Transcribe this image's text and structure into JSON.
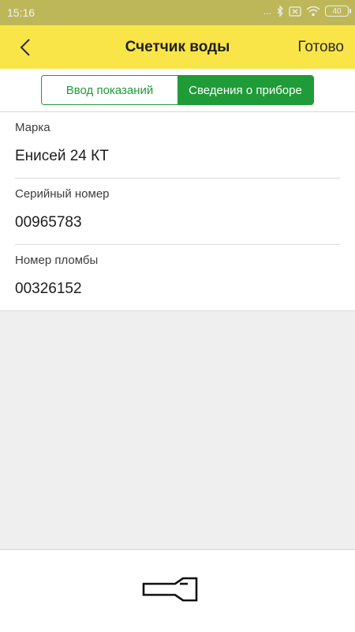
{
  "status_bar": {
    "time": "15:16",
    "dots": "...",
    "battery": "40",
    "icons": [
      "bluetooth-icon",
      "sim-icon",
      "wifi-icon",
      "battery-icon"
    ]
  },
  "app_bar": {
    "title": "Счетчик воды",
    "done_label": "Готово",
    "back_icon": "chevron-left-icon",
    "background": "#f9e547"
  },
  "tabs": [
    {
      "label": "Ввод показаний",
      "selected": false
    },
    {
      "label": "Сведения о приборе",
      "selected": true
    }
  ],
  "accent_color": "#1f9b37",
  "fields": [
    {
      "label": "Марка",
      "value": "Енисей 24 КТ"
    },
    {
      "label": "Серийный номер",
      "value": "00965783"
    },
    {
      "label": "Номер пломбы",
      "value": "00326152"
    }
  ],
  "bottom_bar": {
    "action_icon": "flashlight-icon"
  }
}
